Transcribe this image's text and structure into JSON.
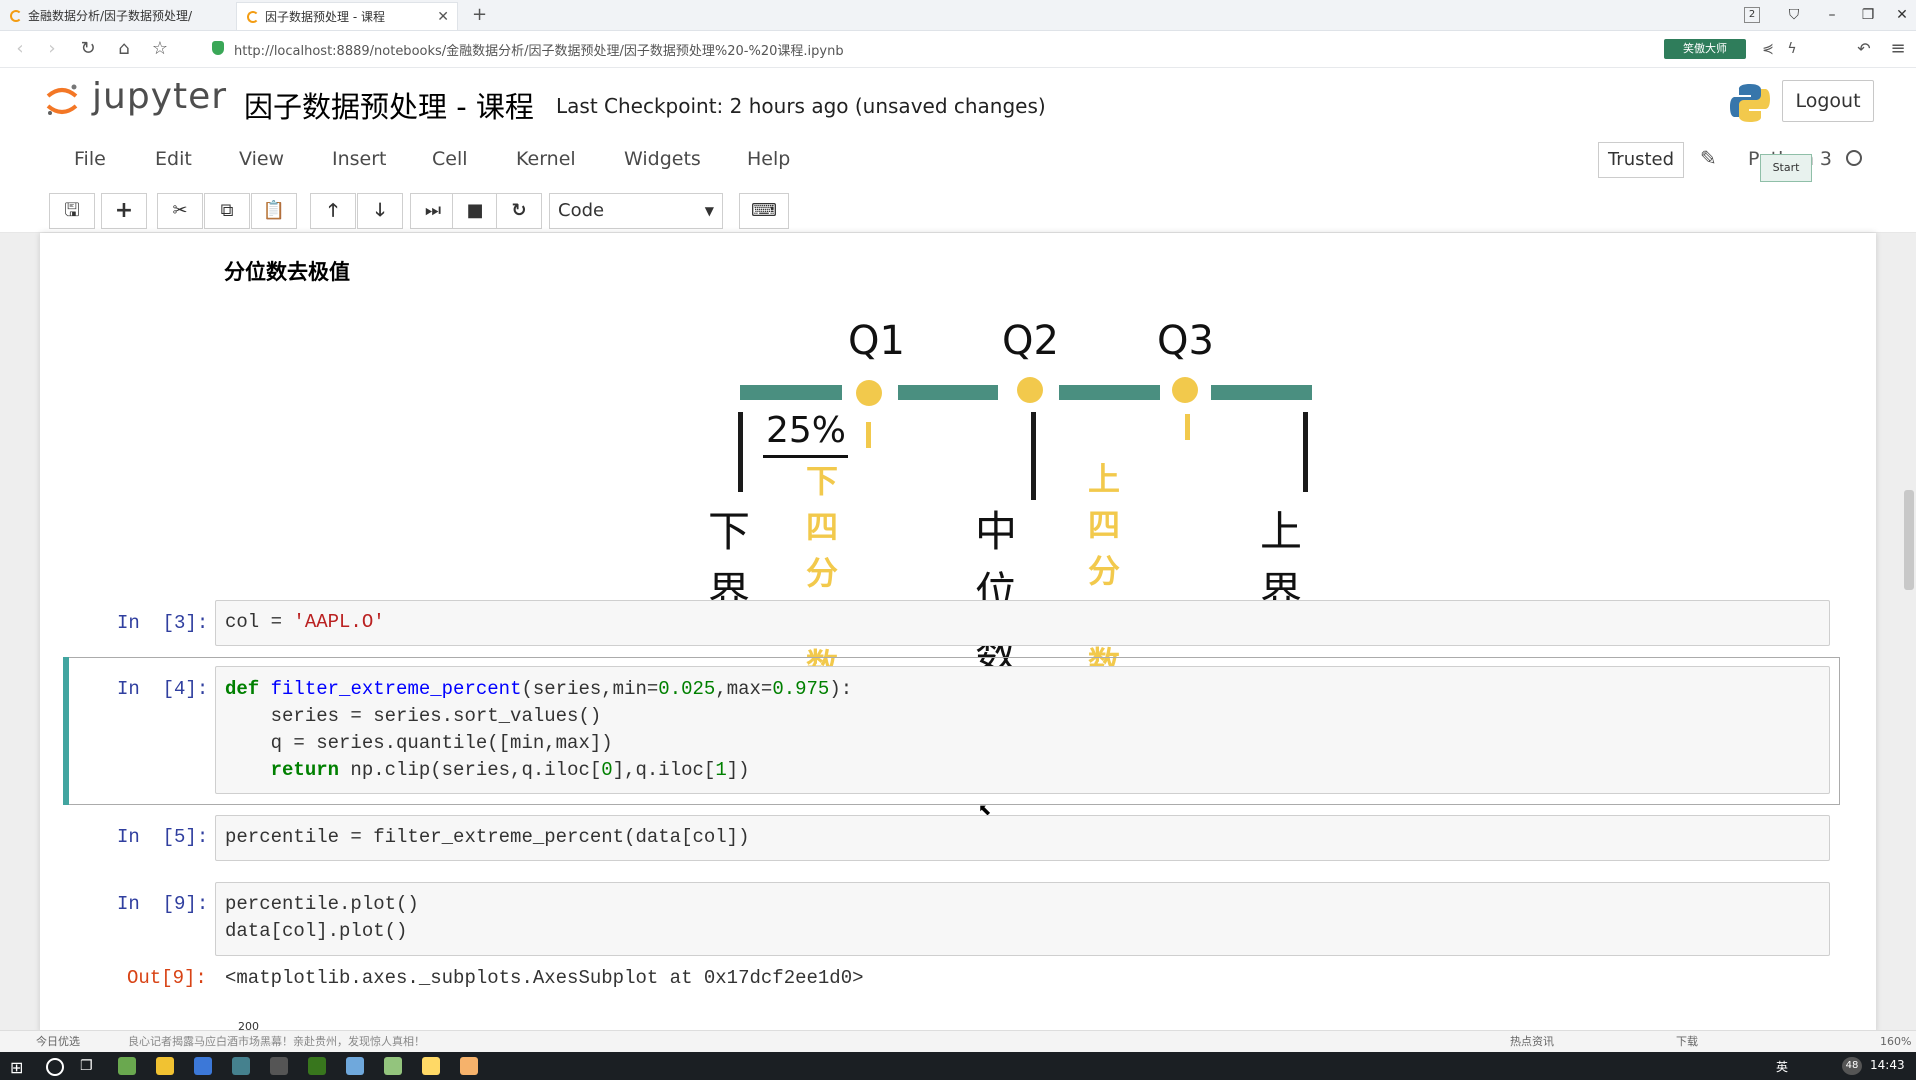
{
  "browser": {
    "tabs": [
      {
        "title": "金融数据分析/因子数据预处理/",
        "active": false
      },
      {
        "title": "因子数据预处理 - 课程",
        "active": true
      }
    ],
    "new_tab": "+",
    "url": "http://localhost:8889/notebooks/金融数据分析/因子数据预处理/因子数据预处理%20-%20课程.ipynb",
    "extension_label": "笑傲大师",
    "tab_count_badge": "2"
  },
  "jupyter": {
    "logo_text": "jupyter",
    "notebook_title": "因子数据预处理 - 课程",
    "checkpoint": "Last Checkpoint: 2 hours ago (unsaved changes)",
    "logout_label": "Logout",
    "menu": [
      "File",
      "Edit",
      "View",
      "Insert",
      "Cell",
      "Kernel",
      "Widgets",
      "Help"
    ],
    "trusted_label": "Trusted",
    "kernel_name": "Python 3",
    "start_popup": "Start",
    "cell_type": "Code"
  },
  "markdown": {
    "heading": "分位数去极值"
  },
  "diagram": {
    "q1": "Q1",
    "q2": "Q2",
    "q3": "Q3",
    "percent": "25%",
    "lower_quartile": "下四分位数",
    "upper_quartile": "上四分位数",
    "lower_bound": "下界",
    "median": "中位数",
    "upper_bound": "上界",
    "colors": {
      "bar": "#4a8f80",
      "dot": "#f2c94c"
    }
  },
  "cells": {
    "c3": {
      "prompt": "In  [3]:"
    },
    "c4": {
      "prompt": "In  [4]:"
    },
    "c5": {
      "prompt": "In  [5]:"
    },
    "c9": {
      "prompt": "In  [9]:",
      "out_prompt": "Out[9]:",
      "output": "<matplotlib.axes._subplots.AxesSubplot at 0x17dcf2ee1d0>"
    }
  },
  "plot_peek": "200",
  "infobar": {
    "left": "今日优选",
    "news": "良心记者揭露马应白酒市场黑幕！亲赴贵州，发现惊人真相！",
    "right_items": [
      "热点资讯",
      "下载"
    ],
    "zoom": "160%"
  },
  "taskbar": {
    "time": "14:43",
    "ime": "英",
    "notification_count": "48"
  }
}
